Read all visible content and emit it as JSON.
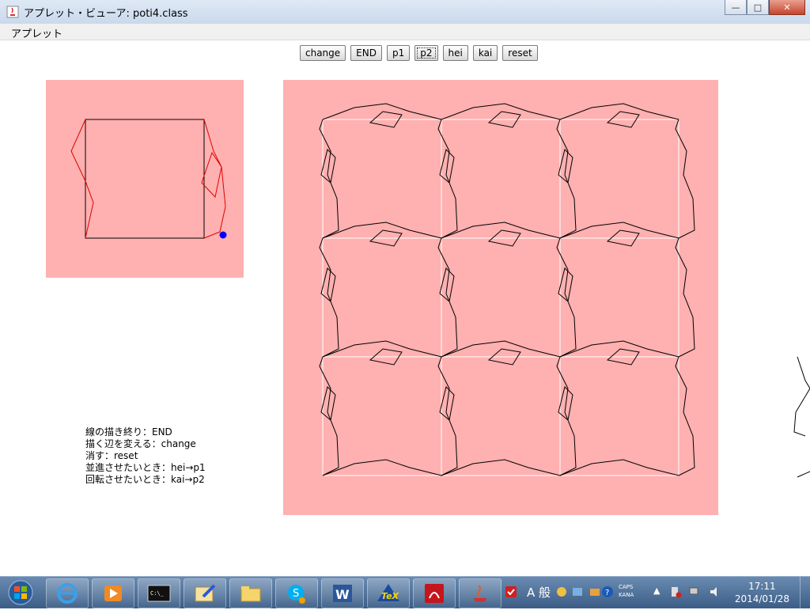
{
  "window": {
    "title": "アプレット・ビューア: poti4.class"
  },
  "menu": {
    "applet": "アプレット"
  },
  "buttons": [
    {
      "label": "change"
    },
    {
      "label": "END"
    },
    {
      "label": "p1"
    },
    {
      "label": "p2"
    },
    {
      "label": "hei"
    },
    {
      "label": "kai"
    },
    {
      "label": "reset"
    }
  ],
  "instructions": [
    "線の描き終り：END",
    "描く辺を変える：change",
    "消す：reset",
    "並進させたいとき：hei→p1",
    "回転させたいとき：kai→p2"
  ],
  "colors": {
    "canvas_bg": "#ffb0b0",
    "edited_edge": "#e00000",
    "tile_line": "#000000",
    "handle": "#0000ff"
  },
  "taskbar": {
    "apps": [
      "internet-explorer-icon",
      "media-player-icon",
      "command-prompt-icon",
      "paint-icon",
      "explorer-icon",
      "skype-icon",
      "word-icon",
      "tex-icon",
      "acrobat-icon",
      "java-icon"
    ],
    "ime": "A 般",
    "caps": "CAPS",
    "kana": "KANA",
    "time": "17:11",
    "date": "2014/01/28"
  }
}
